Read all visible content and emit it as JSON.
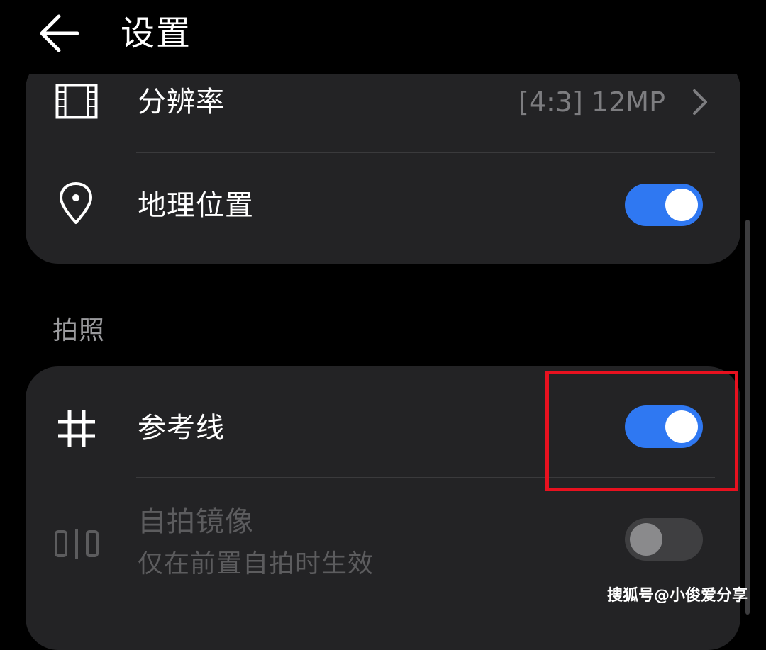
{
  "header": {
    "title": "设置"
  },
  "settings_top": {
    "resolution": {
      "label": "分辨率",
      "value": "[4:3] 12MP",
      "icon": "resolution-frame-icon"
    },
    "location": {
      "label": "地理位置",
      "enabled": true,
      "icon": "location-pin-icon"
    }
  },
  "section_photo": {
    "title": "拍照",
    "grid_lines": {
      "label": "参考线",
      "enabled": true,
      "icon": "grid-icon"
    },
    "selfie_mirror": {
      "label": "自拍镜像",
      "description": "仅在前置自拍时生效",
      "enabled": false,
      "disabled": true,
      "icon": "mirror-icon"
    }
  },
  "watermark": "搜狐号@小俊爱分享",
  "colors": {
    "toggle_on": "#2f78f2",
    "highlight": "#e8111f",
    "card_bg": "#232325"
  }
}
